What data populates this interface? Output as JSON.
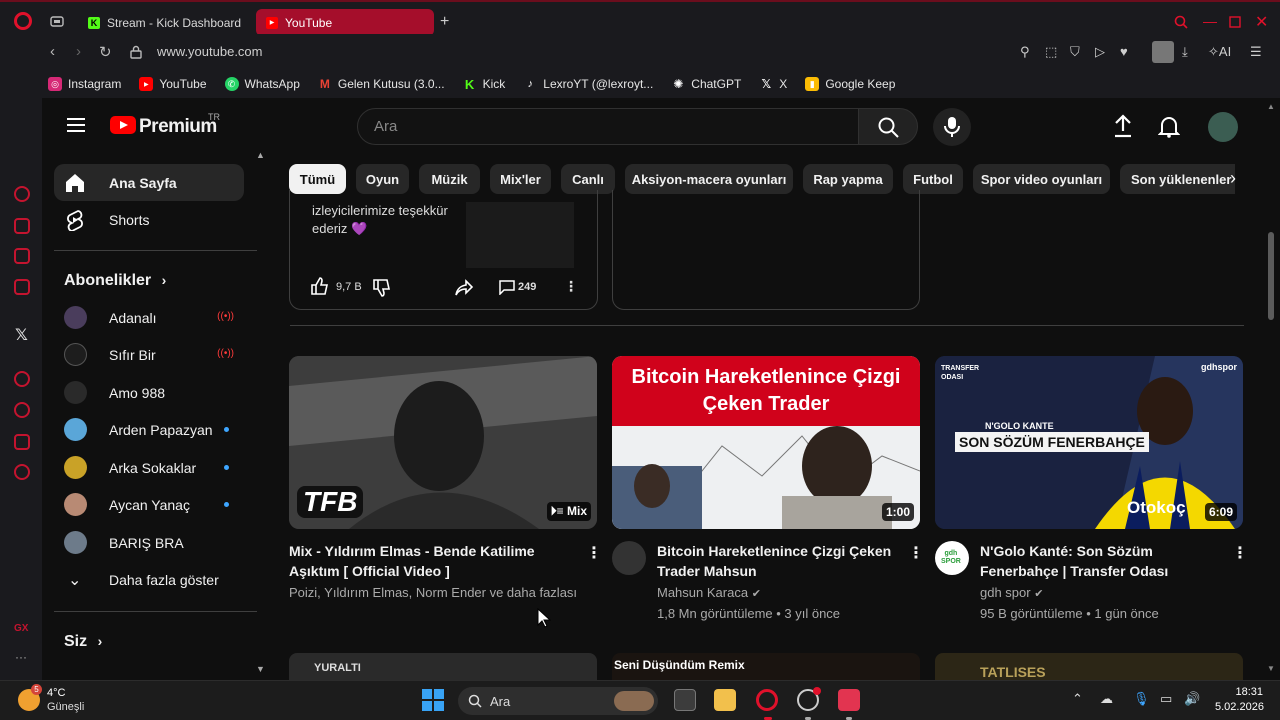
{
  "browser": {
    "tabs": [
      {
        "label": "Stream - Kick Dashboard",
        "active": false
      },
      {
        "label": "YouTube",
        "active": true
      }
    ],
    "url": "www.youtube.com",
    "ext_ai_label": "AI",
    "bookmarks": [
      {
        "label": "Instagram",
        "icon": "instagram-icon",
        "color": "#d62976"
      },
      {
        "label": "YouTube",
        "icon": "youtube-icon",
        "color": "#ff0000"
      },
      {
        "label": "WhatsApp",
        "icon": "whatsapp-icon",
        "color": "#25d366"
      },
      {
        "label": "Gelen Kutusu (3.0...",
        "icon": "gmail-icon",
        "color": "#ea4335"
      },
      {
        "label": "Kick",
        "icon": "kick-icon",
        "color": "#53fc18"
      },
      {
        "label": "LexroYT (@lexroyt...",
        "icon": "tiktok-icon",
        "color": "#111111"
      },
      {
        "label": "ChatGPT",
        "icon": "chatgpt-icon",
        "color": "#444444"
      },
      {
        "label": "X",
        "icon": "x-icon",
        "color": "#111111"
      },
      {
        "label": "Google Keep",
        "icon": "keep-icon",
        "color": "#fbbc04"
      }
    ]
  },
  "youtube": {
    "brand": "Premium",
    "region": "TR",
    "search_placeholder": "Ara",
    "chips": [
      "Tümü",
      "Oyun",
      "Müzik",
      "Mix'ler",
      "Canlı",
      "Aksiyon-macera oyunları",
      "Rap yapma",
      "Futbol",
      "Spor video oyunları",
      "Son yüklenenler"
    ],
    "active_chip": "Tümü",
    "sidebar": {
      "home": "Ana Sayfa",
      "shorts": "Shorts",
      "subscriptions_title": "Abonelikler",
      "subscriptions": [
        {
          "name": "Adanalı",
          "status": "live"
        },
        {
          "name": "Sıfır Bir",
          "status": "live"
        },
        {
          "name": "Amo 988",
          "status": ""
        },
        {
          "name": "Arden Papazyan",
          "status": "new"
        },
        {
          "name": "Arka Sokaklar",
          "status": "new"
        },
        {
          "name": "Aycan Yanaç",
          "status": "new"
        },
        {
          "name": "BARIŞ BRA",
          "status": ""
        }
      ],
      "show_more": "Daha fazla göster",
      "you_title": "Siz"
    },
    "post": {
      "text": "izleyicilerimize teşekkür ederiz 💜",
      "likes": "9,7 B",
      "comments": "249"
    },
    "videos": [
      {
        "title": "Mix - Yıldırım Elmas - Bende Katilime Aşıktım  [ Official Video ]",
        "channel": "Poizi, Yıldırım Elmas, Norm Ender ve daha fazlası",
        "stats": "",
        "badge": "Mix",
        "thumb_text": "TFB"
      },
      {
        "title": "Bitcoin Hareketlenince Çizgi Çeken Trader Mahsun",
        "channel": "Mahsun Karaca",
        "stats": "1,8 Mn görüntüleme • 3 yıl önce",
        "badge": "1:00",
        "thumb_text": "Bitcoin Hareketlenince Çizgi Çeken Trader",
        "verified": true
      },
      {
        "title": "N'Golo Kanté: Son Sözüm Fenerbahçe | Transfer Odası",
        "channel": "gdh spor",
        "stats": "95 B görüntüleme • 1 gün önce",
        "badge": "6:09",
        "thumb_text": "SON SÖZÜM FENERBAHÇE",
        "thumb_small": "N'GOLO KANTE",
        "thumb_brand": "gdhspor",
        "thumb_sponsor": "Otokoç",
        "verified": true
      }
    ],
    "peek": [
      "YURALTI",
      "Seni Düşündüm Remix",
      "TATLISES"
    ]
  },
  "taskbar": {
    "temp": "4°C",
    "condition": "Güneşli",
    "weather_badge": "5",
    "search": "Ara",
    "time": "18:31",
    "date": "5.02.2026"
  },
  "colors": {
    "opera_red": "#e0112b",
    "active_tab": "#a50e2b",
    "youtube_red": "#ff0000",
    "verified_gray": "#aaaaaa",
    "live_red": "#ff3b3b",
    "new_dot": "#3ea6ff"
  }
}
